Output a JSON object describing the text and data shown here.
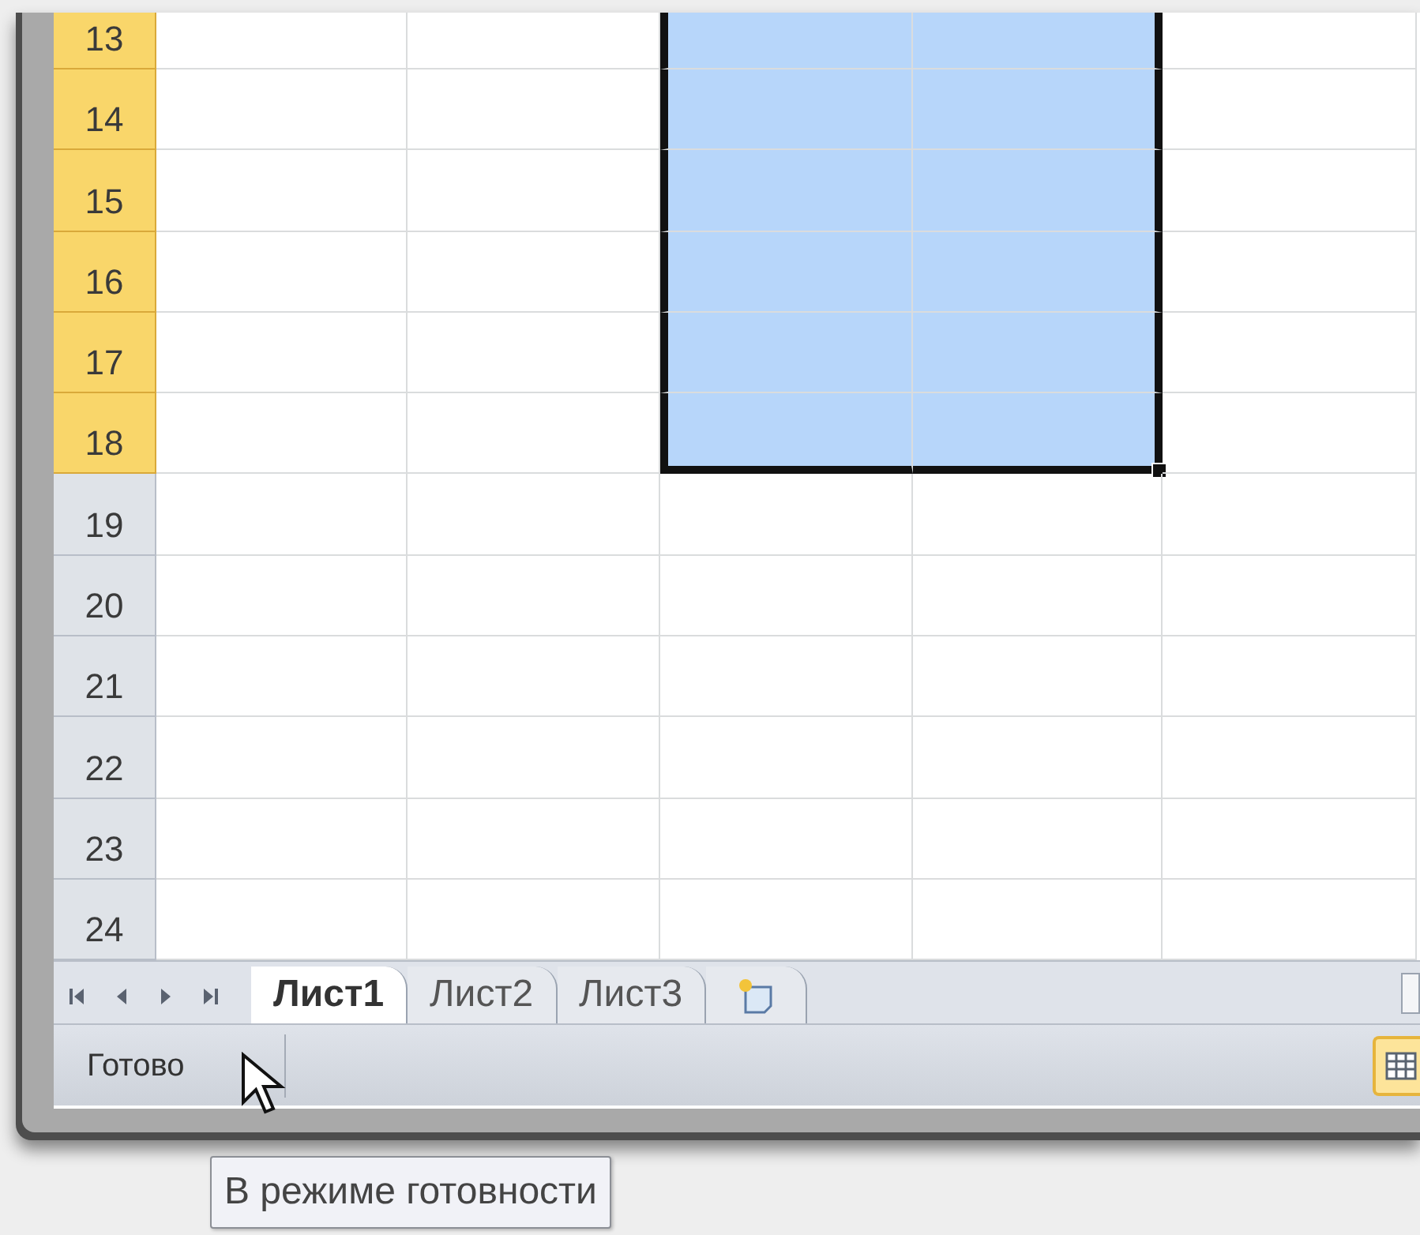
{
  "rows": [
    {
      "label": "13",
      "selected": true,
      "cells": [
        {
          "selected": false
        },
        {
          "selected": false
        },
        {
          "selected": true
        },
        {
          "selected": true
        },
        {
          "selected": false
        }
      ]
    },
    {
      "label": "14",
      "selected": true,
      "cells": [
        {
          "selected": false
        },
        {
          "selected": false
        },
        {
          "selected": true
        },
        {
          "selected": true
        },
        {
          "selected": false
        }
      ]
    },
    {
      "label": "15",
      "selected": true,
      "cells": [
        {
          "selected": false
        },
        {
          "selected": false
        },
        {
          "selected": true
        },
        {
          "selected": true
        },
        {
          "selected": false
        }
      ]
    },
    {
      "label": "16",
      "selected": true,
      "cells": [
        {
          "selected": false
        },
        {
          "selected": false
        },
        {
          "selected": true
        },
        {
          "selected": true
        },
        {
          "selected": false
        }
      ]
    },
    {
      "label": "17",
      "selected": true,
      "cells": [
        {
          "selected": false
        },
        {
          "selected": false
        },
        {
          "selected": true
        },
        {
          "selected": true
        },
        {
          "selected": false
        }
      ]
    },
    {
      "label": "18",
      "selected": true,
      "cells": [
        {
          "selected": false
        },
        {
          "selected": false
        },
        {
          "selected": true
        },
        {
          "selected": true
        },
        {
          "selected": false
        }
      ]
    },
    {
      "label": "19",
      "selected": false,
      "cells": [
        {
          "selected": false
        },
        {
          "selected": false
        },
        {
          "selected": false
        },
        {
          "selected": false
        },
        {
          "selected": false
        }
      ]
    },
    {
      "label": "20",
      "selected": false,
      "cells": [
        {
          "selected": false
        },
        {
          "selected": false
        },
        {
          "selected": false
        },
        {
          "selected": false
        },
        {
          "selected": false
        }
      ]
    },
    {
      "label": "21",
      "selected": false,
      "cells": [
        {
          "selected": false
        },
        {
          "selected": false
        },
        {
          "selected": false
        },
        {
          "selected": false
        },
        {
          "selected": false
        }
      ]
    },
    {
      "label": "22",
      "selected": false,
      "cells": [
        {
          "selected": false
        },
        {
          "selected": false
        },
        {
          "selected": false
        },
        {
          "selected": false
        },
        {
          "selected": false
        }
      ]
    },
    {
      "label": "23",
      "selected": false,
      "cells": [
        {
          "selected": false
        },
        {
          "selected": false
        },
        {
          "selected": false
        },
        {
          "selected": false
        },
        {
          "selected": false
        }
      ]
    },
    {
      "label": "24",
      "selected": false,
      "cells": [
        {
          "selected": false
        },
        {
          "selected": false
        },
        {
          "selected": false
        },
        {
          "selected": false
        },
        {
          "selected": false
        }
      ]
    }
  ],
  "sheet_tabs": [
    {
      "label": "Лист1",
      "selected": true
    },
    {
      "label": "Лист2",
      "selected": false
    },
    {
      "label": "Лист3",
      "selected": false
    }
  ],
  "status_bar": {
    "text": "Готово",
    "view_button": {
      "selected": true
    }
  },
  "tooltip": "В режиме готовности"
}
